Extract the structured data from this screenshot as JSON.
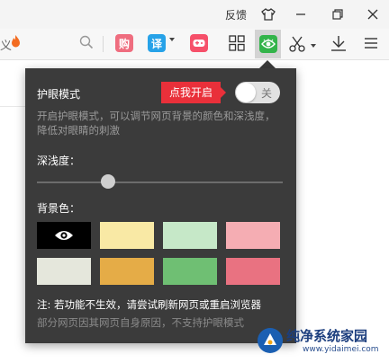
{
  "titlebar": {
    "feedback": "反馈"
  },
  "toolbar": {
    "url_tail": "义",
    "ext_gou": "购",
    "ext_yi": "译"
  },
  "popup": {
    "title": "护眼模式",
    "tip": "点我开启",
    "toggle_label": "关",
    "toggle_on": false,
    "description": "开启护眼模式，可以调节网页背景的颜色和深浅度，降低对眼睛的刺激",
    "depth_label": "深浅度：",
    "depth_value": 0.29,
    "bg_label": "背景色：",
    "swatches": [
      {
        "color": "#000000",
        "selected": true
      },
      {
        "color": "#f9e9a5"
      },
      {
        "color": "#c6e8c8"
      },
      {
        "color": "#f5adb3"
      },
      {
        "color": "#e5e7dc"
      },
      {
        "color": "#e5ac47"
      },
      {
        "color": "#6fbf73"
      },
      {
        "color": "#e97281"
      }
    ],
    "note": "注: 若功能不生效，请尝试刷新网页或重启浏览器",
    "sub_note": "部分网页因其网页自身原因，不支持护眼模式"
  },
  "watermark": {
    "title": "纯净系统家园",
    "url": "www.yidaimei.com"
  }
}
